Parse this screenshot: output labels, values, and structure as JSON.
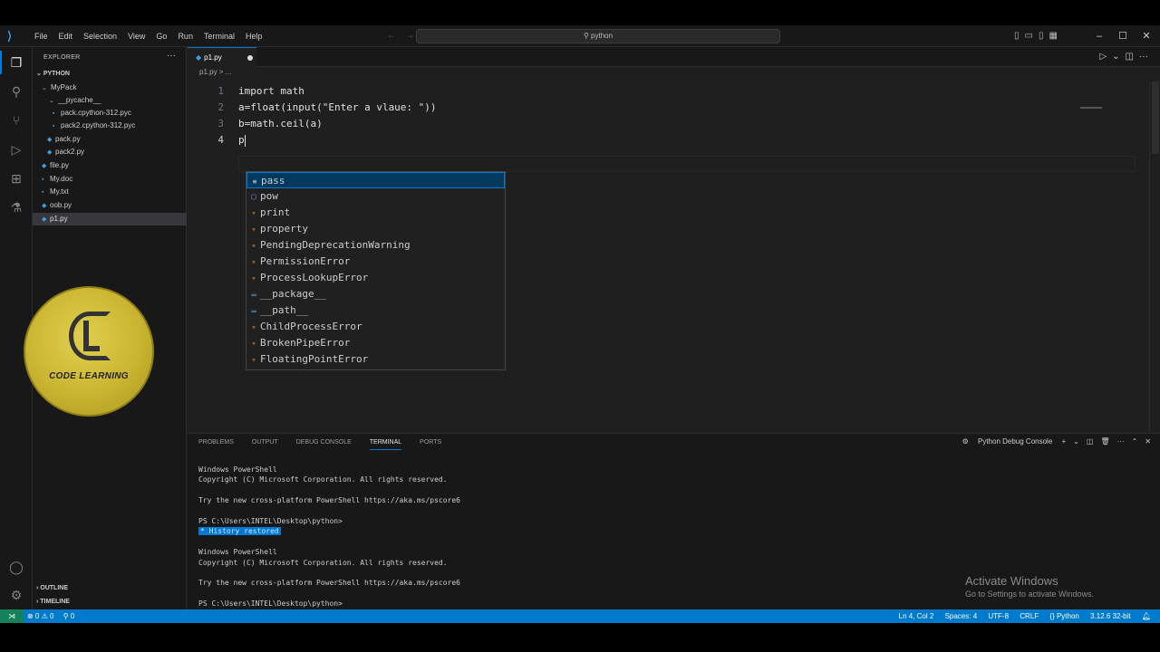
{
  "menu": [
    "File",
    "Edit",
    "Selection",
    "View",
    "Go",
    "Run",
    "Terminal",
    "Help"
  ],
  "search": {
    "text": "python"
  },
  "explorer": {
    "title": "EXPLORER",
    "root": "PYTHON",
    "items": [
      {
        "label": "MyPack",
        "kind": "folder"
      },
      {
        "label": "__pycache__",
        "kind": "folder"
      },
      {
        "label": "pack.cpython-312.pyc",
        "kind": "file"
      },
      {
        "label": "pack2.cpython-312.pyc",
        "kind": "file"
      },
      {
        "label": "pack.py",
        "kind": "py"
      },
      {
        "label": "pack2.py",
        "kind": "py"
      },
      {
        "label": "file.py",
        "kind": "py"
      },
      {
        "label": "My.doc",
        "kind": "file"
      },
      {
        "label": "My.txt",
        "kind": "file"
      },
      {
        "label": "oob.py",
        "kind": "py"
      },
      {
        "label": "p1.py",
        "kind": "py",
        "selected": true
      }
    ],
    "outline": "OUTLINE",
    "timeline": "TIMELINE"
  },
  "logo": {
    "text": "CODE LEARNING"
  },
  "editor": {
    "tab": "p1.py",
    "breadcrumb": "p1.py > ...",
    "lines": [
      {
        "n": "1",
        "text": "import math"
      },
      {
        "n": "2",
        "text": "a=float(input(\"Enter a vlaue: \"))"
      },
      {
        "n": "3",
        "text": "b=math.ceil(a)"
      },
      {
        "n": "4",
        "text": "p"
      }
    ]
  },
  "suggestions": [
    {
      "label": "pass",
      "icon": "keyword"
    },
    {
      "label": "pow",
      "icon": "function"
    },
    {
      "label": "print",
      "icon": "class"
    },
    {
      "label": "property",
      "icon": "class"
    },
    {
      "label": "PendingDeprecationWarning",
      "icon": "class"
    },
    {
      "label": "PermissionError",
      "icon": "class"
    },
    {
      "label": "ProcessLookupError",
      "icon": "class"
    },
    {
      "label": "__package__",
      "icon": "variable"
    },
    {
      "label": "__path__",
      "icon": "variable"
    },
    {
      "label": "ChildProcessError",
      "icon": "class"
    },
    {
      "label": "BrokenPipeError",
      "icon": "class"
    },
    {
      "label": "FloatingPointError",
      "icon": "class"
    }
  ],
  "panel": {
    "tabs": [
      "PROBLEMS",
      "OUTPUT",
      "DEBUG CONSOLE",
      "TERMINAL",
      "PORTS"
    ],
    "active_tab": "TERMINAL",
    "debug_console": "Python Debug Console",
    "terminal": [
      "Windows PowerShell",
      "Copyright (C) Microsoft Corporation. All rights reserved.",
      "",
      "Try the new cross-platform PowerShell https://aka.ms/pscore6",
      "",
      "PS C:\\Users\\INTEL\\Desktop\\python>",
      "History restored",
      "",
      "Windows PowerShell",
      "Copyright (C) Microsoft Corporation. All rights reserved.",
      "",
      "Try the new cross-platform PowerShell https://aka.ms/pscore6",
      "",
      "PS C:\\Users\\INTEL\\Desktop\\python>"
    ]
  },
  "watermark": {
    "line1": "Activate Windows",
    "line2": "Go to Settings to activate Windows."
  },
  "status": {
    "problems": "⊗ 0 ⚠ 0",
    "ports": "⚲ 0",
    "position": "Ln 4, Col 2",
    "spaces": "Spaces: 4",
    "encoding": "UTF-8",
    "eol": "CRLF",
    "language": "{} Python",
    "interpreter": "3.12.6 32-bit"
  }
}
